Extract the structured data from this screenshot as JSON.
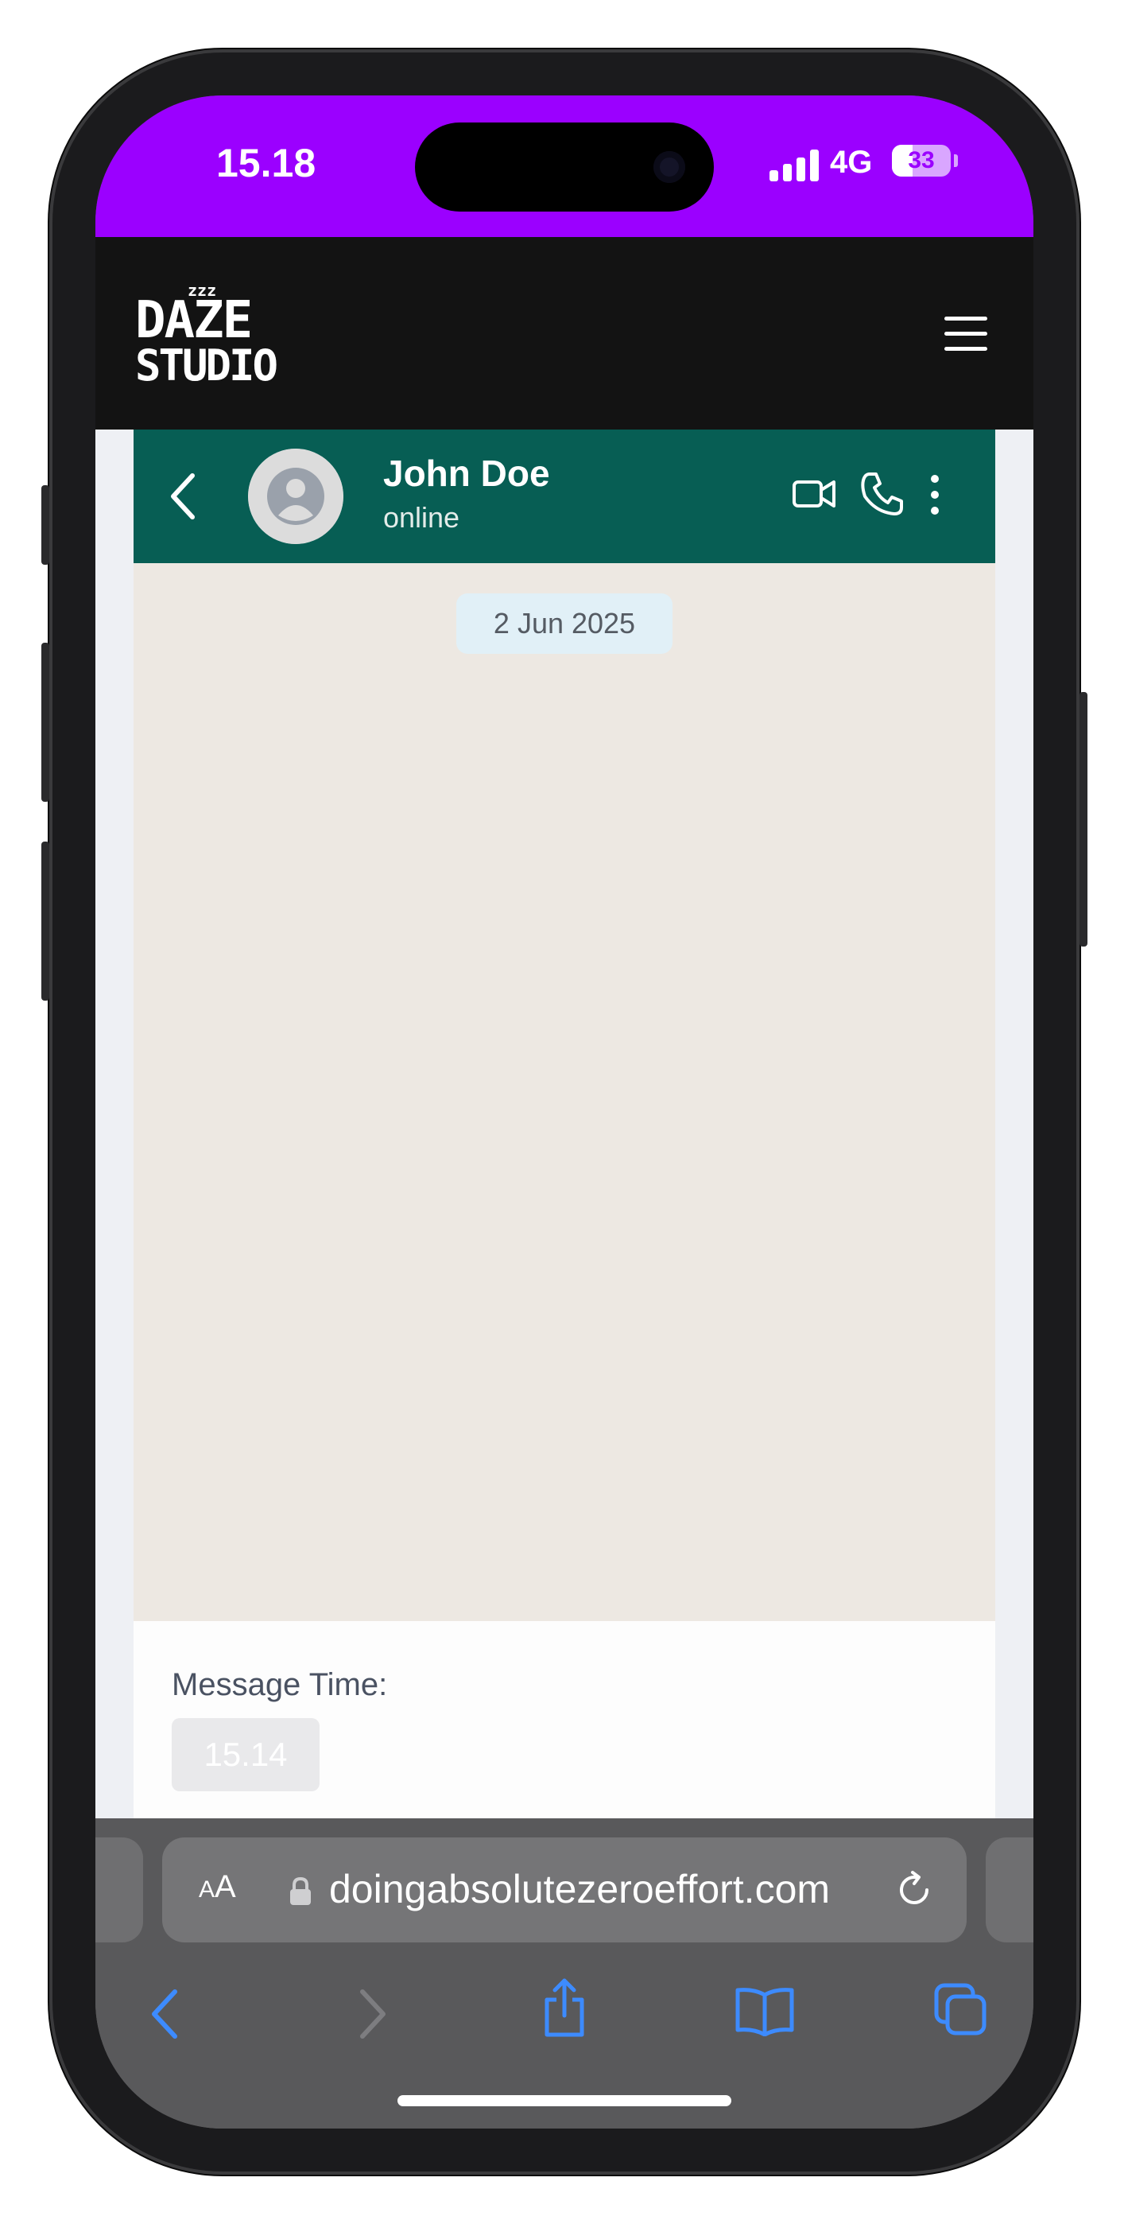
{
  "status_bar": {
    "time": "15.18",
    "network": "4G",
    "battery": "33"
  },
  "site": {
    "logo_top": "DAZE",
    "logo_bottom": "STUDIO",
    "logo_zzz": "zzz"
  },
  "chat": {
    "contact_name": "John Doe",
    "contact_status": "online",
    "date_pill": "2 Jun 2025"
  },
  "form": {
    "message_time_label": "Message Time:",
    "message_time_value": "15.14"
  },
  "browser": {
    "text_size": "AA",
    "url": "doingabsolutezeroeffort.com"
  },
  "colors": {
    "status_bar": "#9b00ff",
    "nav_bg": "#131313",
    "chat_header": "#075e54",
    "chat_bg": "#ede8e2",
    "date_pill": "#e1f0f7",
    "safari_accent": "#3d8bff"
  },
  "icons": [
    "back-chevron-icon",
    "avatar-icon",
    "video-call-icon",
    "phone-icon",
    "more-vert-icon",
    "hamburger-menu-icon",
    "lock-icon",
    "reload-icon",
    "safari-back-icon",
    "safari-forward-icon",
    "share-icon",
    "bookmarks-icon",
    "tabs-icon"
  ]
}
